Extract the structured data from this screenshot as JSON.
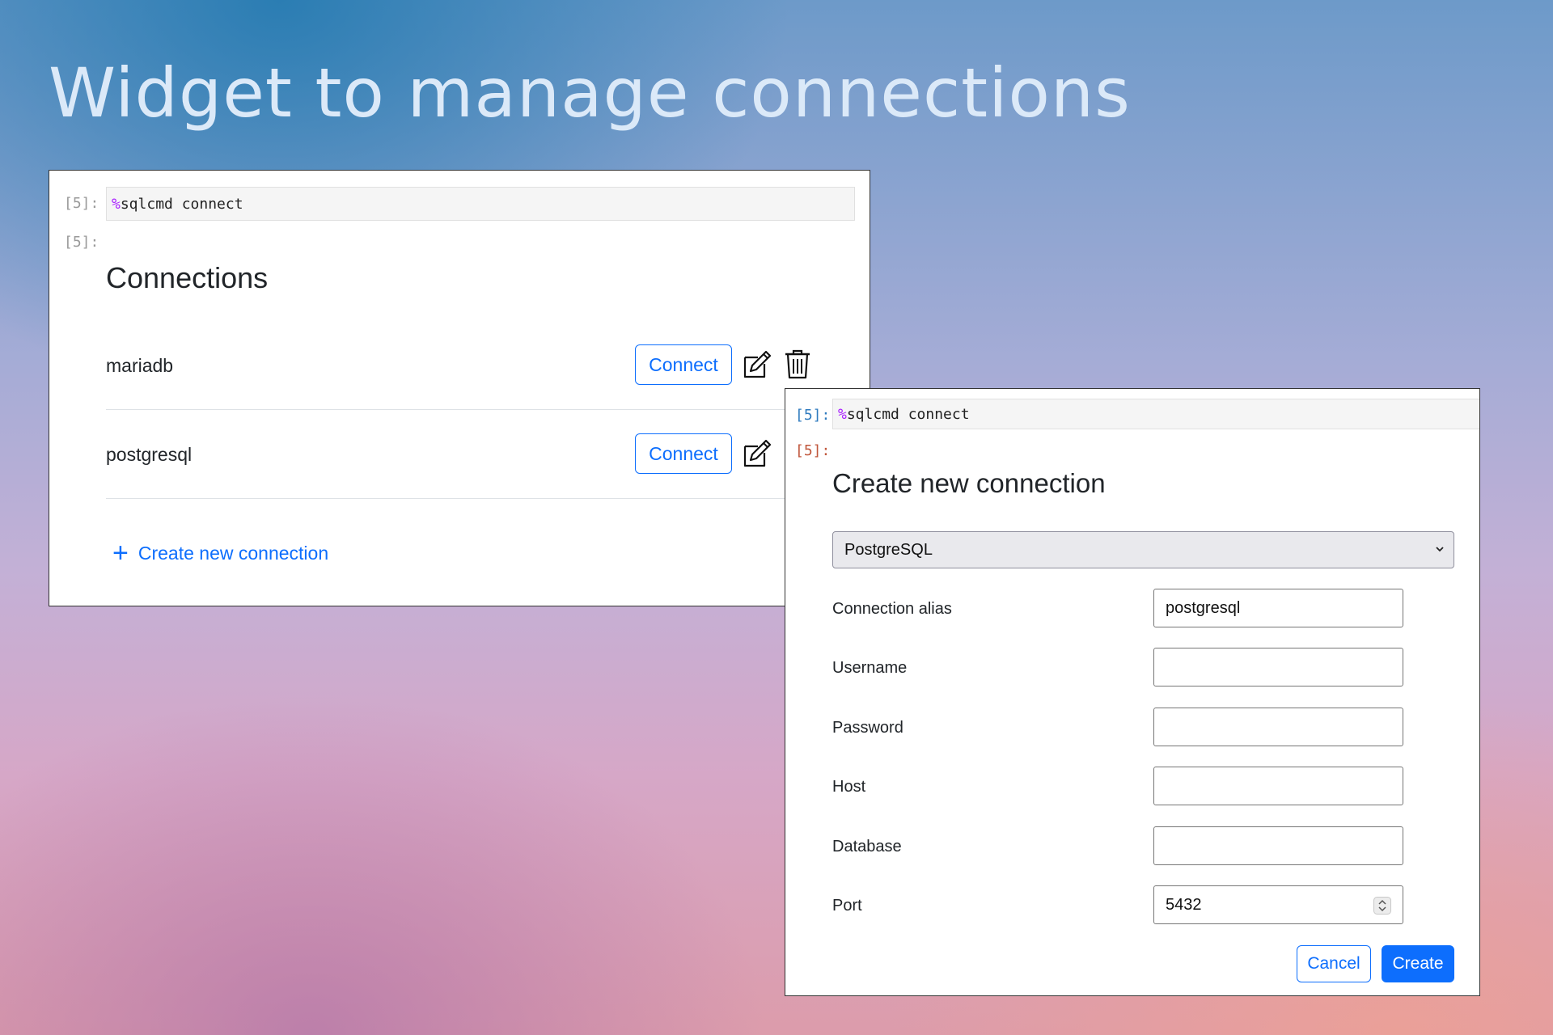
{
  "headline": "Widget to manage connections",
  "colors": {
    "accent": "#0d6efd",
    "magic": "#aa22ff"
  },
  "widget1": {
    "in_prompt": "[5]:",
    "out_prompt": "[5]:",
    "code_magic": "%",
    "code_rest": "sqlcmd connect",
    "title": "Connections",
    "connections": [
      {
        "name": "mariadb",
        "connect_label": "Connect",
        "icons": [
          "edit-icon",
          "trash-icon"
        ]
      },
      {
        "name": "postgresql",
        "connect_label": "Connect",
        "icons": [
          "edit-icon"
        ]
      }
    ],
    "create_link": "Create new connection",
    "create_icon": "plus-icon"
  },
  "widget2": {
    "in_prompt": "[5]:",
    "out_prompt": "[5]:",
    "code_magic": "%",
    "code_rest": "sqlcmd connect",
    "title": "Create new connection",
    "db_type": "PostgreSQL",
    "fields": [
      {
        "label": "Connection alias",
        "value": "postgresql"
      },
      {
        "label": "Username",
        "value": ""
      },
      {
        "label": "Password",
        "value": ""
      },
      {
        "label": "Host",
        "value": ""
      },
      {
        "label": "Database",
        "value": ""
      },
      {
        "label": "Port",
        "value": "5432"
      }
    ],
    "cancel_label": "Cancel",
    "create_label": "Create"
  }
}
